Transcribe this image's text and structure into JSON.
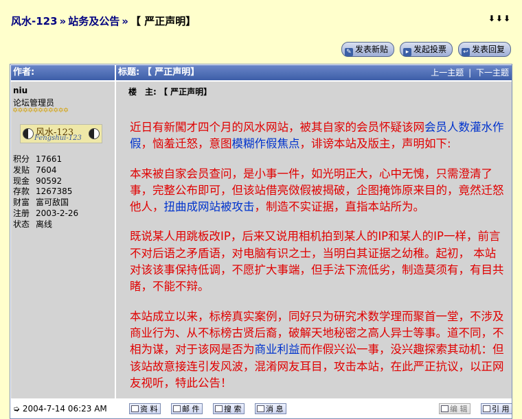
{
  "breadcrumb": {
    "site": "风水-123",
    "sep": "»",
    "forum": "站务及公告",
    "current": "【 严正声明】"
  },
  "top_arrows": "⬇⬇⬇",
  "actions": {
    "new_topic": "发表新贴",
    "new_poll": "发起投票",
    "reply": "发表回复"
  },
  "header": {
    "author_label": "作者:",
    "title_label": "标题: 【 严正声明】",
    "prev": "上一主题",
    "nav_sep": "|",
    "next": "下一主题"
  },
  "user": {
    "name": "niu",
    "role": "论坛管理员",
    "stars": "✡✡✡✡✡✡✡✡✡✡✡",
    "logo_text": "风水-123",
    "logo_sub": "Fengshui-123",
    "stats": [
      {
        "k": "积分",
        "v": "17661"
      },
      {
        "k": "发贴",
        "v": "7604"
      },
      {
        "k": "现金",
        "v": "90592"
      },
      {
        "k": "存款",
        "v": "1267385"
      },
      {
        "k": "财富",
        "v": "富可敌国"
      },
      {
        "k": "注册",
        "v": "2003-2-26"
      },
      {
        "k": "状态",
        "v": "离线"
      }
    ]
  },
  "post": {
    "title": "楼　主: 【 严正声明】",
    "p1a": "近日有新闖才四个月的风水网站，被其自家的会员怀疑该网",
    "p1hl1": "会员人数灌水作假",
    "p1b": "，恼羞迁怒，意图",
    "p1hl2": "模糊作假焦点",
    "p1c": "，诽谤本站及版主，声明如下:",
    "p2a": "本来被自家会员查问，是小事一件，如光明正大，心中无愧，只需澄清了事，完整公布即可，但该站借亮傚假被揭破，企图掩饰原来目的，竟然迁怒他人，",
    "p2hl": "扭曲成网站被攻击",
    "p2b": "，制造不实证据，直指本站所为。",
    "p3": "既说某人用跳板改IP，后来又说用相机拍到某人的IP和某人的IP一样，前言不对后语之矛盾语，对电脑有识之士，当明白其证据之幼稚。起初， 本站对该该事保持低调，不愿扩大事端，但手法下流低劣，制造莫须有，有目共睹，不能不辩。",
    "p4a": "本站成立以来，标榜真实案例，同好只为研究术数学理而聚首一堂，不涉及商业行为、从不标榜古贤后裔，破解天地秘密之高人异士等事。道不同，不相为谋，对于该网是否为",
    "p4hl": "商业利益",
    "p4b": "而作假兴讼一事，没兴趣探索其动机：但该站故意接连引发风波，混淆网友耳目，攻击本站，在此严正抗议，以正网友视听，特此公告！"
  },
  "footer": {
    "time_icon": "➭",
    "time": "2004-7-14 06:23 AM",
    "profile": "资 料",
    "email": "邮 件",
    "search": "搜 索",
    "message": "消 息",
    "edit": "编 辑",
    "quote": "引 用"
  },
  "colors": {
    "page_bg": "#ffffcc",
    "header_bar": "#3d5ea8",
    "post_text": "#e00000",
    "highlight": "#0033cc",
    "cell_bg": "#d3d3d3"
  }
}
